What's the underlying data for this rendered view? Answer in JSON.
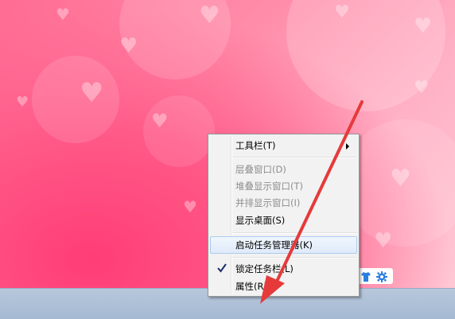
{
  "context_menu": {
    "items": [
      {
        "label": "工具栏(T)"
      },
      {
        "label": "层叠窗口(D)"
      },
      {
        "label": "堆叠显示窗口(T)"
      },
      {
        "label": "并排显示窗口(I)"
      },
      {
        "label": "显示桌面(S)"
      },
      {
        "label": "启动任务管理器(K)"
      },
      {
        "label": "锁定任务栏(L)"
      },
      {
        "label": "属性(R)"
      }
    ]
  },
  "tray": {
    "icons": [
      "shirt-icon",
      "gear-icon"
    ],
    "icon_color": "#2a7fe0"
  },
  "annotation": {
    "arrow_color": "#e63a3a"
  },
  "wallpaper": {
    "base_color": "#ff6b93"
  }
}
